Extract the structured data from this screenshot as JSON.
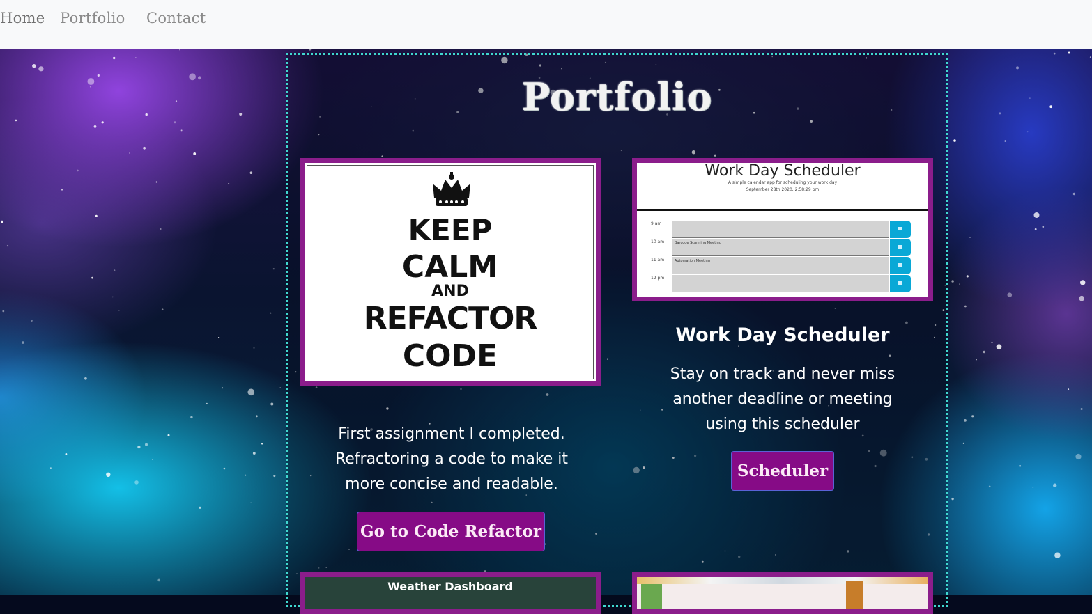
{
  "nav": {
    "items": [
      {
        "label": "Home"
      },
      {
        "label": "Portfolio"
      },
      {
        "label": "Contact"
      }
    ]
  },
  "page": {
    "title": "Portfolio"
  },
  "projects": [
    {
      "image": {
        "lines": [
          "KEEP",
          "CALM",
          "AND",
          "REFACTOR",
          "CODE"
        ],
        "icon": "crown-icon"
      },
      "description": "First assignment I completed. Refractoring a code to make it more concise and readable.",
      "button": "Go to Code Refactor"
    },
    {
      "image": {
        "title": "Work Day Scheduler",
        "subtitle": "A simple calendar app for scheduling your work day",
        "date": "September 28th 2020, 2:58:29 pm",
        "rows": [
          {
            "hour": "9 am",
            "event": ""
          },
          {
            "hour": "10 am",
            "event": "Barcode Scanning Meeting"
          },
          {
            "hour": "11 am",
            "event": "Automation Meeting"
          },
          {
            "hour": "12 pm",
            "event": ""
          }
        ]
      },
      "title": "Work Day Scheduler",
      "description": "Stay on track and never miss another deadline or meeting using this scheduler",
      "button": "Scheduler"
    },
    {
      "image": {
        "title": "Weather Dashboard"
      }
    },
    {
      "image": {}
    }
  ],
  "colors": {
    "card_border": "#8b1d8b",
    "button_bg": "#860b86",
    "container_border": "#40d8d0",
    "navbar_bg": "#f8f9fa"
  }
}
